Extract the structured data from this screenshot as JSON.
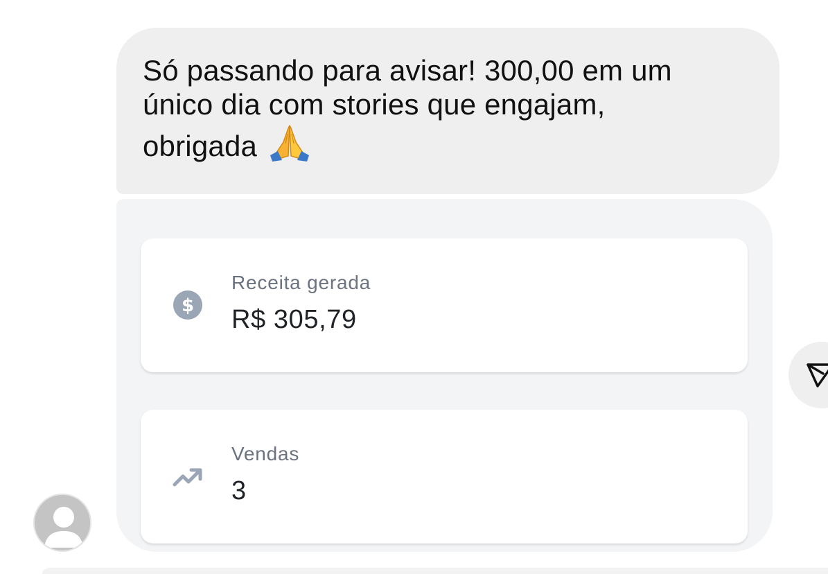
{
  "message": {
    "lines": [
      "Só passando para avisar! 300,00 em um",
      "único dia com stories que engajam,",
      "obrigada"
    ],
    "emoji": "🙏"
  },
  "stats": {
    "revenue": {
      "label": "Receita gerada",
      "value": "R$ 305,79",
      "icon": "dollar-circle-icon"
    },
    "sales": {
      "label": "Vendas",
      "value": "3",
      "icon": "trending-up-icon"
    }
  },
  "colors": {
    "bubble": "#efefef",
    "media_bubble": "#f3f4f6",
    "card": "#ffffff",
    "label": "#6b7280",
    "icon": "#9aa5b5"
  }
}
